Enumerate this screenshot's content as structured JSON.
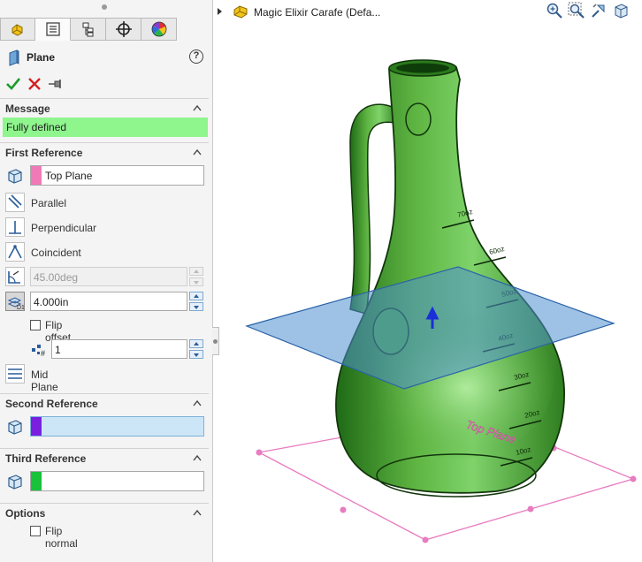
{
  "panel": {
    "tabs": [
      {
        "name": "feature-manager-tab",
        "icon": "feature-manager-icon"
      },
      {
        "name": "property-manager-tab",
        "icon": "property-manager-icon"
      },
      {
        "name": "configuration-manager-tab",
        "icon": "configuration-manager-icon"
      },
      {
        "name": "dimxpert-manager-tab",
        "icon": "crosshair-icon"
      },
      {
        "name": "display-manager-tab",
        "icon": "color-wheel-icon"
      }
    ],
    "title": "Plane",
    "help": "?",
    "message": {
      "header": "Message",
      "text": "Fully defined",
      "color": "#8ff58d"
    },
    "first_reference": {
      "header": "First Reference",
      "value": "Top Plane",
      "swatch_color": "#f07ab8",
      "constraints": {
        "parallel": "Parallel",
        "perpendicular": "Perpendicular",
        "coincident": "Coincident",
        "angle": "45.00deg",
        "distance": "4.000in",
        "flip_offset": "Flip offset",
        "instances": "1",
        "mid_plane": "Mid Plane"
      }
    },
    "second_reference": {
      "header": "Second Reference",
      "value": "",
      "swatch_color": "#7a1fe0"
    },
    "third_reference": {
      "header": "Third Reference",
      "value": "",
      "swatch_color": "#18c23a"
    },
    "options": {
      "header": "Options",
      "flip_normal": "Flip normal"
    }
  },
  "graphics": {
    "tree_title": "Magic Elixir Carafe  (Defa...",
    "plane_label": "Top Plane",
    "scale_marks": [
      "70oz",
      "60oz",
      "50oz",
      "40oz",
      "30oz",
      "20oz",
      "10oz"
    ],
    "colors": {
      "glass": "#3f9a2a",
      "new_plane": "#4f8fd0",
      "reference_plane": "#e87cc0"
    }
  }
}
